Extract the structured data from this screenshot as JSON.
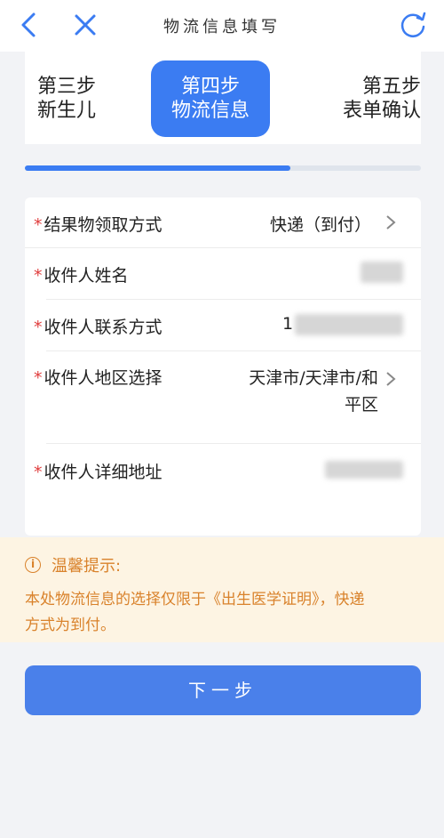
{
  "nav": {
    "title": "物流信息填写"
  },
  "steps": [
    {
      "line1": "第三步",
      "line2": "新生儿",
      "active": false
    },
    {
      "line1": "第四步",
      "line2": "物流信息",
      "active": true
    },
    {
      "line1": "第五步",
      "line2": "表单确认",
      "active": false
    }
  ],
  "progress": {
    "fraction": 0.67
  },
  "form": {
    "pickup": {
      "label": "结果物领取方式",
      "value": "快递（到付）"
    },
    "name": {
      "label": "收件人姓名"
    },
    "phone": {
      "label": "收件人联系方式",
      "value_prefix": "1"
    },
    "region": {
      "label": "收件人地区选择",
      "line1": "天津市/天津市/和",
      "line2": "平区"
    },
    "address": {
      "label": "收件人详细地址"
    },
    "required_mark": "*"
  },
  "tip": {
    "icon": "info-icon",
    "title": "温馨提示:",
    "body_line1": "本处物流信息的选择仅限于《出生医学证明》，快递",
    "body_line2": "方式为到付。"
  },
  "next_button": {
    "label": "下一步"
  },
  "colors": {
    "accent": "#3b7cf2",
    "required": "#e03c3c",
    "tip_text": "#d9822b",
    "tip_bg": "#fdf4e3"
  }
}
